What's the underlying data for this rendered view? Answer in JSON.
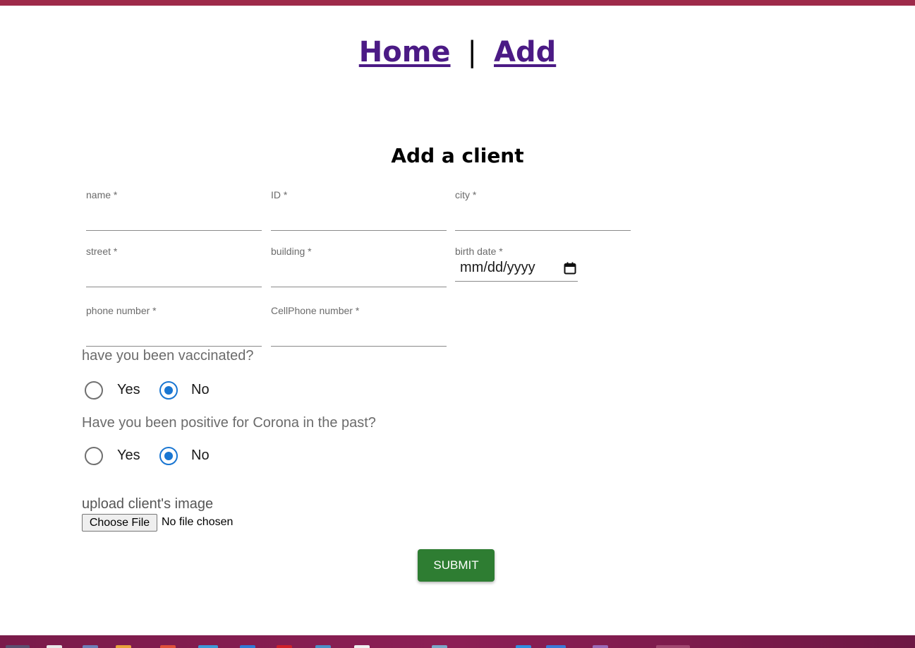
{
  "nav": {
    "home": "Home",
    "separator": "|",
    "add": "Add"
  },
  "form": {
    "title": "Add a client",
    "fields": {
      "name": "name *",
      "id": "ID *",
      "city": "city *",
      "street": "street *",
      "building": "building *",
      "birth_date": "birth date *",
      "birth_date_placeholder": "mm/dd/yyyy",
      "phone": "phone number *",
      "cellphone": "CellPhone number *"
    },
    "vaccinated": {
      "question": "have you been vaccinated?",
      "yes": "Yes",
      "no": "No",
      "selected": "No"
    },
    "corona": {
      "question": "Have you been positive for Corona in the past?",
      "yes": "Yes",
      "no": "No",
      "selected": "No"
    },
    "upload": {
      "label": "upload client's image",
      "button": "Choose File",
      "status": "No file chosen"
    },
    "submit": "SUBMIT"
  },
  "colors": {
    "accent_bar": "#9e2a4a",
    "link": "#4b1a85",
    "radio_checked": "#1976d2",
    "submit": "#2e7d32"
  }
}
